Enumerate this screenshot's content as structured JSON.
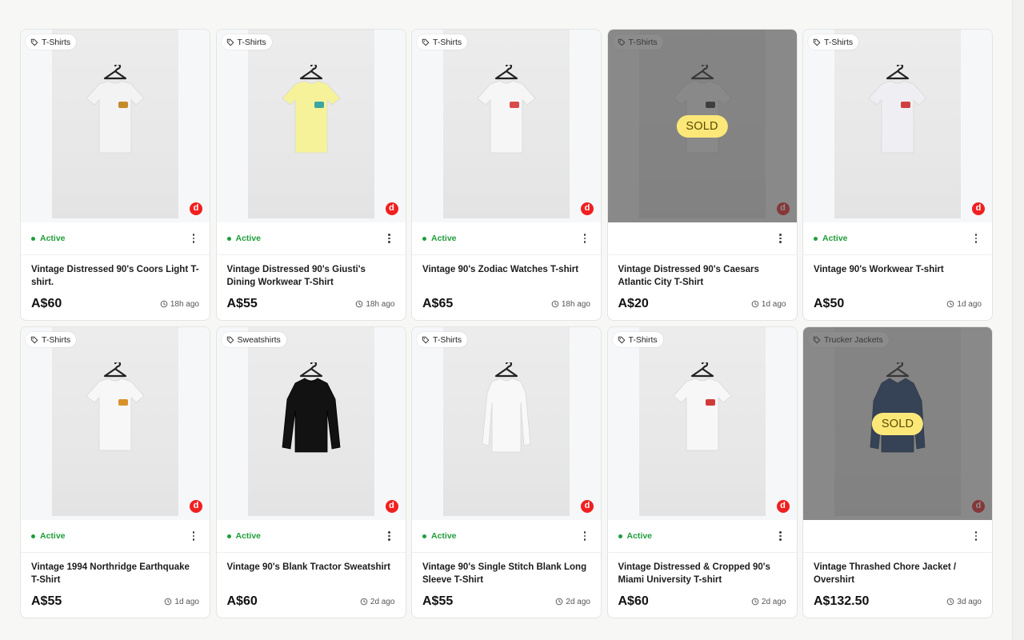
{
  "listings": [
    {
      "category": "T-Shirts",
      "status": "Active",
      "sold": false,
      "title": "Vintage Distressed 90's Coors Light T-shirt.",
      "price": "A$60",
      "time": "18h ago",
      "garment": "tee",
      "color": "#f3f3f4",
      "graphic": "#c58a2a"
    },
    {
      "category": "T-Shirts",
      "status": "Active",
      "sold": false,
      "title": "Vintage Distressed 90's Giusti's Dining Workwear T-Shirt",
      "price": "A$55",
      "time": "18h ago",
      "garment": "tee",
      "color": "#f6f29a",
      "graphic": "#3aa7a0"
    },
    {
      "category": "T-Shirts",
      "status": "Active",
      "sold": false,
      "title": "Vintage 90's Zodiac Watches T-shirt",
      "price": "A$65",
      "time": "18h ago",
      "garment": "tee",
      "color": "#f6f6f7",
      "graphic": "#d94a4a"
    },
    {
      "category": "T-Shirts",
      "status": "",
      "sold": true,
      "sold_label": "SOLD",
      "title": "Vintage Distressed 90's Caesars Atlantic City T-Shirt",
      "price": "A$20",
      "time": "1d ago",
      "garment": "tee",
      "color": "#f6f6f7",
      "graphic": "#333333"
    },
    {
      "category": "T-Shirts",
      "status": "Active",
      "sold": false,
      "title": "Vintage 90's Workwear T-shirt",
      "price": "A$50",
      "time": "1d ago",
      "garment": "tee",
      "color": "#efeff3",
      "graphic": "#d04040"
    },
    {
      "category": "T-Shirts",
      "status": "Active",
      "sold": false,
      "title": "Vintage 1994 Northridge Earthquake T-Shirt",
      "price": "A$55",
      "time": "1d ago",
      "garment": "tee",
      "color": "#f7f7f7",
      "graphic": "#d9912a"
    },
    {
      "category": "Sweatshirts",
      "status": "Active",
      "sold": false,
      "title": "Vintage 90's Blank Tractor Sweatshirt",
      "price": "A$60",
      "time": "2d ago",
      "garment": "sweat",
      "color": "#121212",
      "graphic": ""
    },
    {
      "category": "T-Shirts",
      "status": "Active",
      "sold": false,
      "title": "Vintage 90's Single Stitch Blank Long Sleeve T-Shirt",
      "price": "A$55",
      "time": "2d ago",
      "garment": "long",
      "color": "#f8f8f8",
      "graphic": ""
    },
    {
      "category": "T-Shirts",
      "status": "Active",
      "sold": false,
      "title": "Vintage Distressed & Cropped 90's Miami University T-shirt",
      "price": "A$60",
      "time": "2d ago",
      "garment": "tee",
      "color": "#f7f7f7",
      "graphic": "#d03a3a"
    },
    {
      "category": "Trucker Jackets",
      "status": "",
      "sold": true,
      "sold_label": "SOLD",
      "title": "Vintage Thrashed Chore Jacket / Overshirt",
      "price": "A$132.50",
      "time": "3d ago",
      "garment": "jacket",
      "color": "#1f3d6e",
      "graphic": ""
    }
  ],
  "icons": {
    "tag": "tag-icon",
    "marketplace": "depop-logo-icon",
    "menu": "more-vertical-icon",
    "time": "clock-icon"
  },
  "depop_letter": "d"
}
